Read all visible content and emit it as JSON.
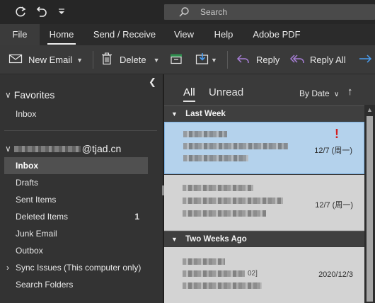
{
  "search": {
    "placeholder": "Search"
  },
  "menu": {
    "tabs": [
      {
        "label": "File"
      },
      {
        "label": "Home"
      },
      {
        "label": "Send / Receive"
      },
      {
        "label": "View"
      },
      {
        "label": "Help"
      },
      {
        "label": "Adobe PDF"
      }
    ],
    "active": "Home"
  },
  "ribbon": {
    "new_email": "New Email",
    "delete": "Delete",
    "reply": "Reply",
    "reply_all": "Reply All"
  },
  "folders": {
    "favorites_label": "Favorites",
    "favorites_items": [
      {
        "label": "Inbox"
      }
    ],
    "account_suffix": "@tjad.cn",
    "items": [
      {
        "label": "Inbox",
        "selected": true
      },
      {
        "label": "Drafts"
      },
      {
        "label": "Sent Items"
      },
      {
        "label": "Deleted Items",
        "count": "1"
      },
      {
        "label": "Junk Email"
      },
      {
        "label": "Outbox"
      },
      {
        "label": "Sync Issues (This computer only)"
      },
      {
        "label": "Search Folders"
      }
    ]
  },
  "messages": {
    "filter_all": "All",
    "filter_unread": "Unread",
    "sort_label": "By Date",
    "groups": [
      {
        "label": "Last Week",
        "items": [
          {
            "date": "12/7 (周一)",
            "important": "!",
            "selected": true
          },
          {
            "date": "12/7 (周一)"
          }
        ]
      },
      {
        "label": "Two Weeks Ago",
        "items": [
          {
            "date": "2020/12/3",
            "snippet_fragment": "02]"
          }
        ]
      }
    ]
  },
  "colors": {
    "app_bg": "#201f1e",
    "folder_pane": "#333333",
    "ribbon": "#3a3a3a",
    "selected_message": "#b4d2ec",
    "importance_red": "#d21f1f",
    "reply_purple": "#a77ed6",
    "forward_blue": "#4a9df0"
  }
}
